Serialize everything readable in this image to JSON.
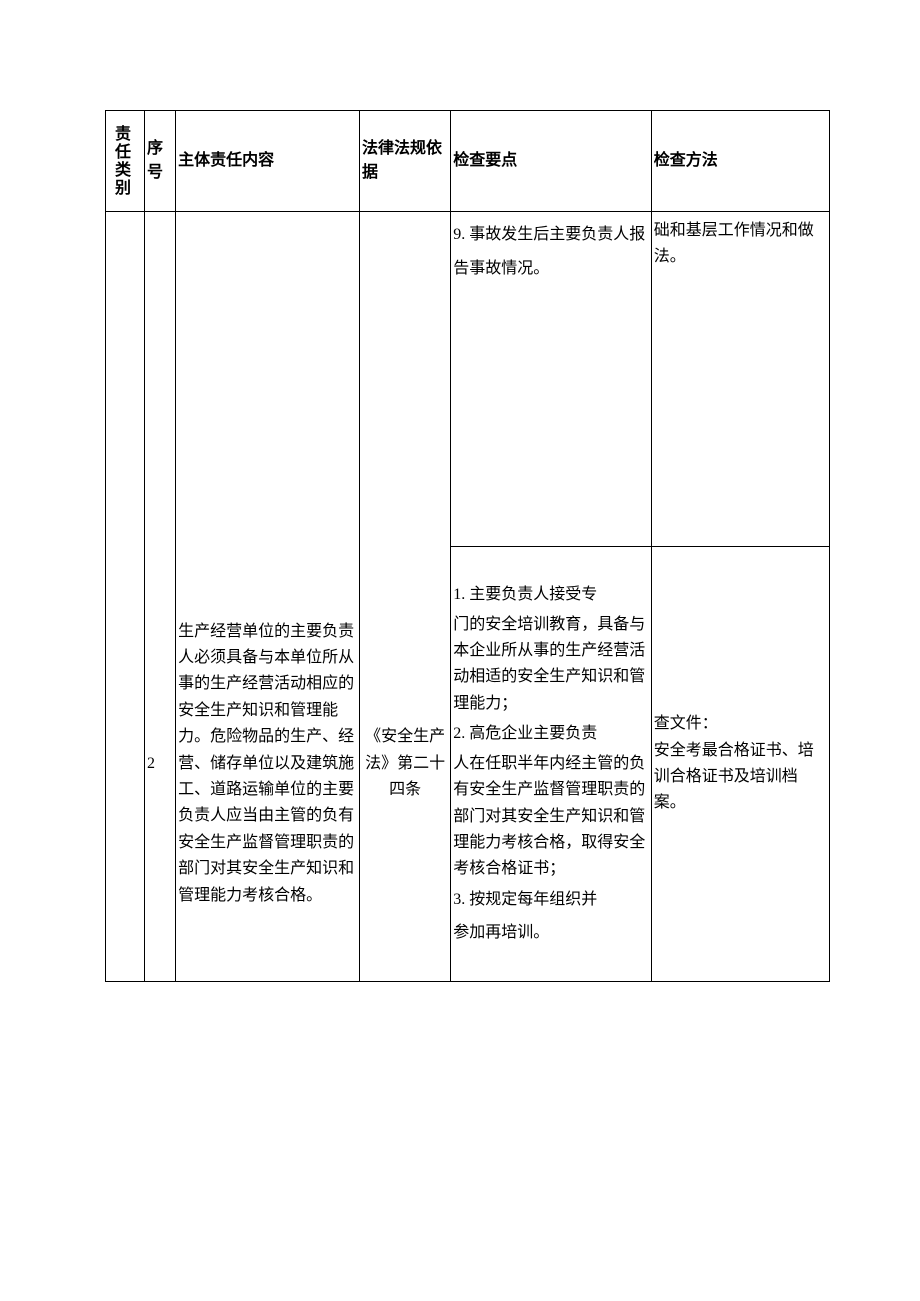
{
  "headers": {
    "category": "责任类别",
    "seq": "序号",
    "content": "主体责任内容",
    "basis": "法律法规依据",
    "points": "检查要点",
    "method": "检查方法"
  },
  "rows": [
    {
      "category": "",
      "seq": "",
      "content": "",
      "basis": "",
      "points": "9. 事故发生后主要负责人报告事故情况。",
      "method": "础和基层工作情况和做法。"
    },
    {
      "category": "",
      "seq": "2",
      "content": "生产经营单位的主要负责人必须具备与本单位所从事的生产经营活动相应的安全生产知识和管理能力。危险物品的生产、经营、储存单位以及建筑施工、道路运输单位的主要负责人应当由主管的负有安全生产监督管理职责的部门对其安全生产知识和管理能力考核合格。",
      "basis": "《安全生产法》第二十四条",
      "points_p1": "1. 主要负责人接受专",
      "points_p2": "门的安全培训教育，具备与本企业所从事的生产经营活动相适的安全生产知识和管理能力；",
      "points_p3": "2. 高危企业主要负责",
      "points_p4": "人在任职半年内经主管的负有安全生产监督管理职责的部门对其安全生产知识和管理能力考核合格，取得安全考核合格证书；",
      "points_p5": "3. 按规定每年组织并",
      "points_p6": "参加再培训。",
      "method": "查文件：\n安全考最合格证书、培训合格证书及培训档案。"
    }
  ]
}
